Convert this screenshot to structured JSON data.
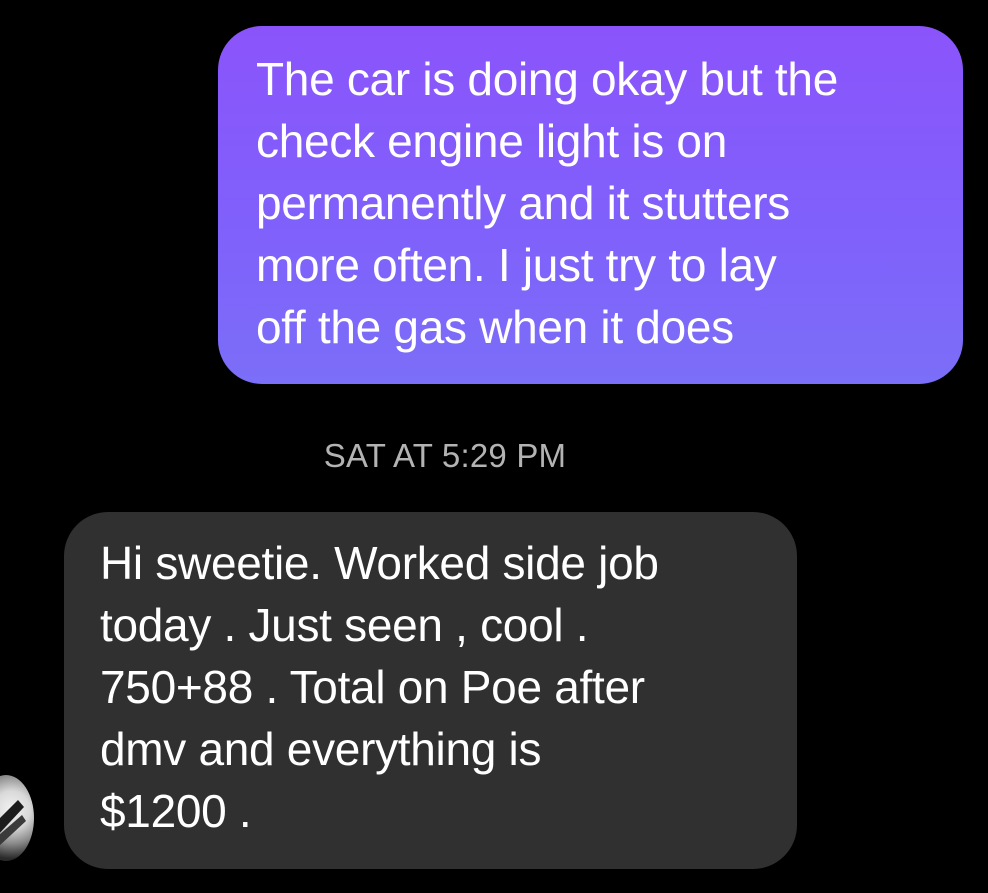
{
  "conversation": {
    "messages": [
      {
        "direction": "sent",
        "text": "The car is doing okay but the\ncheck engine light is on\npermanently and it stutters\nmore often. I just try to lay\noff the gas when it does"
      },
      {
        "direction": "received",
        "text": "Hi sweetie.  Worked side job\ntoday . Just seen , cool .\n750+88 . Total on Poe after\ndmv and everything is\n$1200 ."
      }
    ],
    "timestamp": "SAT AT 5:29 PM"
  },
  "colors": {
    "background": "#000000",
    "sent_bubble": "#8b54fb",
    "received_bubble": "#303030",
    "timestamp_text": "#b3b3b3"
  },
  "icons": {
    "avatar": "contact-avatar"
  }
}
